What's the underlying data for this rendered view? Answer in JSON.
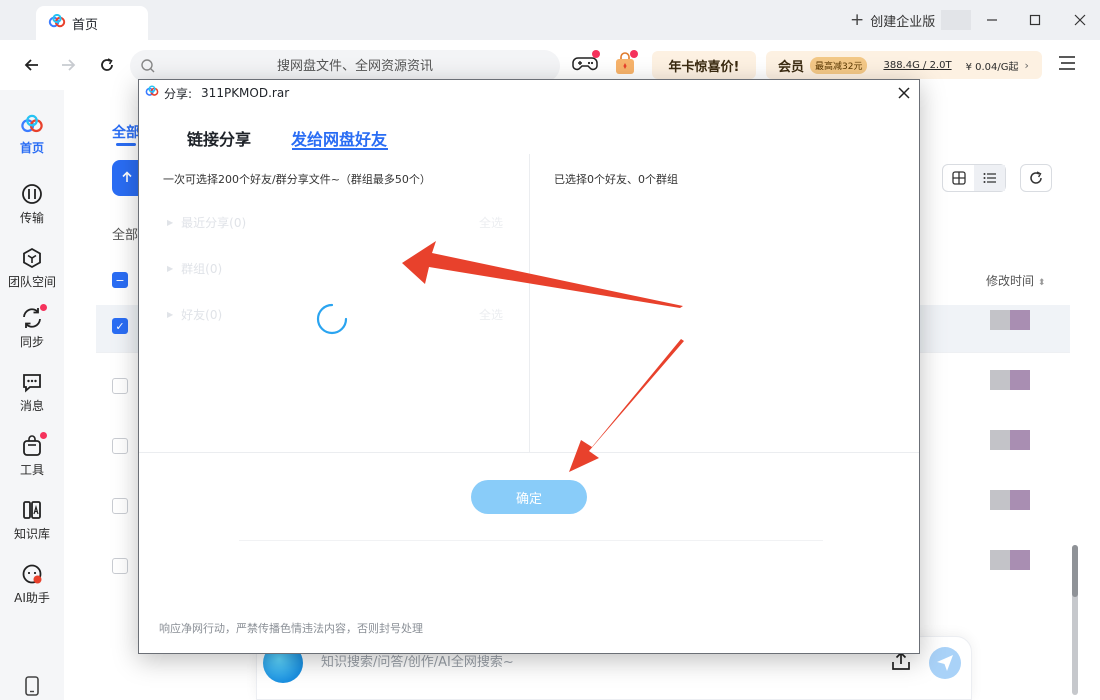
{
  "titlebar": {
    "tab_label": "首页",
    "create_enterprise": "创建企业版"
  },
  "toolbar": {
    "search_placeholder": "搜网盘文件、全网资源资讯",
    "promo_label": "年卡惊喜价!",
    "vip_label": "会员",
    "vip_badge": "最高减32元",
    "vip_storage": "388.4G / 2.0T",
    "vip_price": "¥ 0.04/G起",
    "vip_chevron": "›"
  },
  "sidebar": {
    "items": [
      {
        "label": "首页",
        "icon": "baidu-cloud-logo-icon"
      },
      {
        "label": "传输",
        "icon": "transfer-icon"
      },
      {
        "label": "团队空间",
        "icon": "team-space-icon"
      },
      {
        "label": "同步",
        "icon": "sync-icon"
      },
      {
        "label": "消息",
        "icon": "message-icon"
      },
      {
        "label": "工具",
        "icon": "tools-icon"
      },
      {
        "label": "知识库",
        "icon": "knowledge-base-icon"
      },
      {
        "label": "AI助手",
        "icon": "ai-assistant-icon"
      }
    ]
  },
  "background": {
    "tab_all": "全部",
    "all_label": "全部",
    "modify_time": "修改时间"
  },
  "ai_bar": {
    "placeholder": "知识搜索/问答/创作/AI全网搜索~"
  },
  "dialog": {
    "title_label": "分享:",
    "file_name": "311PKMOD.rar",
    "tabs": {
      "link_share": "链接分享",
      "send_friends": "发给网盘好友"
    },
    "left_note": "一次可选择200个好友/群分享文件~（群组最多50个）",
    "right_note": "已选择0个好友、0个群组",
    "groups": [
      {
        "label": "最近分享(0)",
        "select_all": "全选"
      },
      {
        "label": "群组(0)",
        "select_all": ""
      },
      {
        "label": "好友(0)",
        "select_all": "全选"
      }
    ],
    "confirm_label": "确定",
    "footer_note": "响应净网行动，严禁传播色情违法内容，否则封号处理"
  },
  "colors": {
    "accent_blue": "#2a6df4",
    "arrow_red": "#e8412c",
    "confirm_disabled": "#89ccf9"
  }
}
